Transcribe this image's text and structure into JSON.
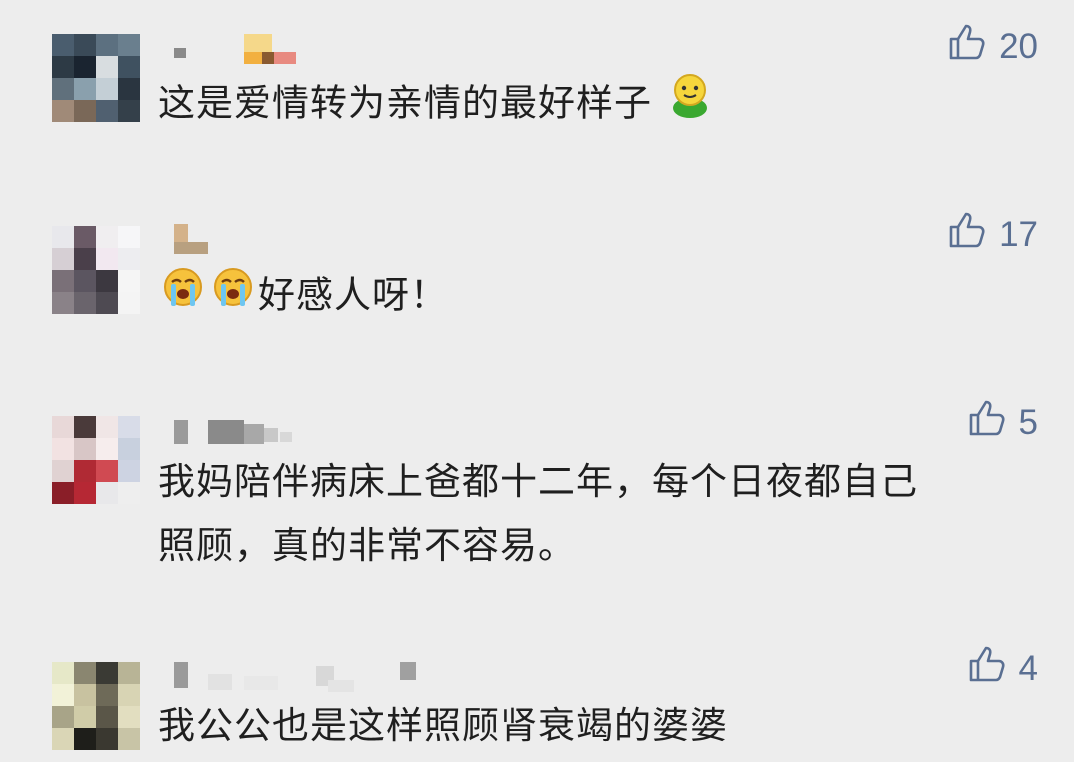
{
  "comments": [
    {
      "text": "这是爱情转为亲情的最好样子",
      "likes": "20",
      "avatar_colors": [
        "#4a5d6e",
        "#3a4a58",
        "#5c7080",
        "#6a7f8e",
        "#2d3a45",
        "#1a2430",
        "#d8dde0",
        "#3f5160",
        "#60707c",
        "#8aa0ad",
        "#c4cfd6",
        "#2a3540",
        "#a08a78",
        "#7a6858",
        "#506070",
        "#34404a"
      ]
    },
    {
      "text": "好感人呀！",
      "likes": "17",
      "avatar_colors": [
        "#e8e8ec",
        "#6a5a66",
        "#f0eef0",
        "#f6f6f8",
        "#d6cfd4",
        "#4a3f4a",
        "#f2e8f0",
        "#ededf0",
        "#7a7078",
        "#5b5560",
        "#3c3840",
        "#f5f5f5",
        "#8a8288",
        "#6a646c",
        "#4e4a52",
        "#f4f4f4"
      ]
    },
    {
      "text_line1": "我妈陪伴病床上爸都十二年，每个日夜都自己",
      "text_line2": "照顾，真的非常不容易。",
      "likes": "5",
      "avatar_colors": [
        "#e8d8d8",
        "#4a3a3a",
        "#f0e6e6",
        "#d8dce8",
        "#f2e2e2",
        "#d8c6c6",
        "#f6eded",
        "#c8d0de",
        "#e0d2d2",
        "#b02a34",
        "#d04a52",
        "#cdd3e2",
        "#8a1e28",
        "#b62834",
        "#e8e8ea",
        "#eeeeee"
      ]
    },
    {
      "text": "我公公也是这样照顾肾衰竭的婆婆",
      "likes": "4",
      "avatar_colors": [
        "#e6e8c8",
        "#8a8670",
        "#3a3a34",
        "#b8b496",
        "#f2f2d8",
        "#c8c2a0",
        "#6e6a58",
        "#d8d4b4",
        "#a8a488",
        "#d0cca8",
        "#5a5648",
        "#e2dec0",
        "#dad6b6",
        "#1e1e1a",
        "#3a3830",
        "#c8c4a6"
      ]
    }
  ]
}
